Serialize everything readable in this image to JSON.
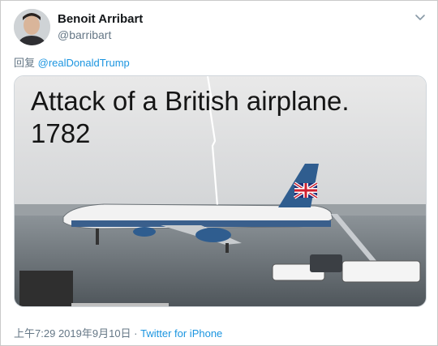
{
  "tweet": {
    "display_name": "Benoit Arribart",
    "handle": "@barribart",
    "reply_prefix": "回复 ",
    "reply_mention": "@realDonaldTrump",
    "image_caption_line1": "Attack of a British airplane.",
    "image_caption_line2": "1782",
    "time": "上午7:29",
    "date": "2019年9月10日",
    "separator": " · ",
    "source": "Twitter for iPhone"
  },
  "icons": {
    "menu": "chevron-down-icon",
    "flag": "union-jack-icon"
  },
  "colors": {
    "link": "#1b95e0",
    "secondary_text": "#657786",
    "primary_text": "#14171a"
  }
}
